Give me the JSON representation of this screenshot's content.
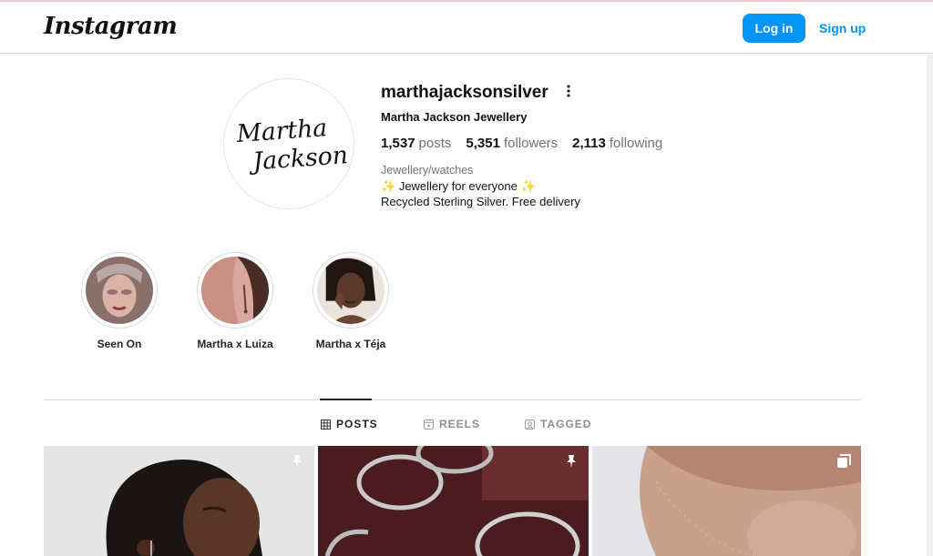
{
  "header": {
    "logo": "Instagram",
    "login_label": "Log in",
    "signup_label": "Sign up",
    "accent_color": "#0095f6"
  },
  "profile": {
    "avatar_text_line1": "Martha",
    "avatar_text_line2": "Jackson",
    "username": "marthajacksonsilver",
    "full_name": "Martha Jackson Jewellery",
    "stats": {
      "posts_count": "1,537",
      "posts_label": "posts",
      "followers_count": "5,351",
      "followers_label": "followers",
      "following_count": "2,113",
      "following_label": "following"
    },
    "category": "Jewellery/watches",
    "bio_line1": "Jewellery for everyone",
    "bio_spark": "✨",
    "bio_line2": "Recycled Sterling Silver. Free delivery"
  },
  "highlights": [
    {
      "label": "Seen On"
    },
    {
      "label": "Martha x Luiza"
    },
    {
      "label": "Martha x Téja"
    }
  ],
  "tabs": [
    {
      "label": "POSTS",
      "icon": "grid-icon",
      "active": true
    },
    {
      "label": "REELS",
      "icon": "reels-icon",
      "active": false
    },
    {
      "label": "TAGGED",
      "icon": "tagged-icon",
      "active": false
    }
  ],
  "posts": [
    {
      "badge": "pin-icon"
    },
    {
      "badge": "pin-icon"
    },
    {
      "badge": "carousel-icon"
    }
  ]
}
